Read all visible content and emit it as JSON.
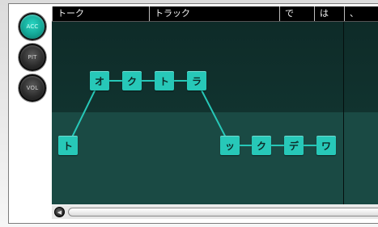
{
  "modes": [
    {
      "label": "ACC",
      "active": true
    },
    {
      "label": "PIT",
      "active": false
    },
    {
      "label": "VOL",
      "active": false
    }
  ],
  "ruler": [
    "トーク",
    "トラック",
    "で",
    "は",
    "、"
  ],
  "notes": [
    "ト",
    "オ",
    "ク",
    "ト",
    "ラ",
    "ッ",
    "ク",
    "デ",
    "ワ"
  ],
  "colors": {
    "accent": "#27c8b8",
    "background": "#0d2624",
    "band_high": "#1a4a44"
  },
  "icons": {
    "scroll_left": "triangle-left-icon"
  }
}
